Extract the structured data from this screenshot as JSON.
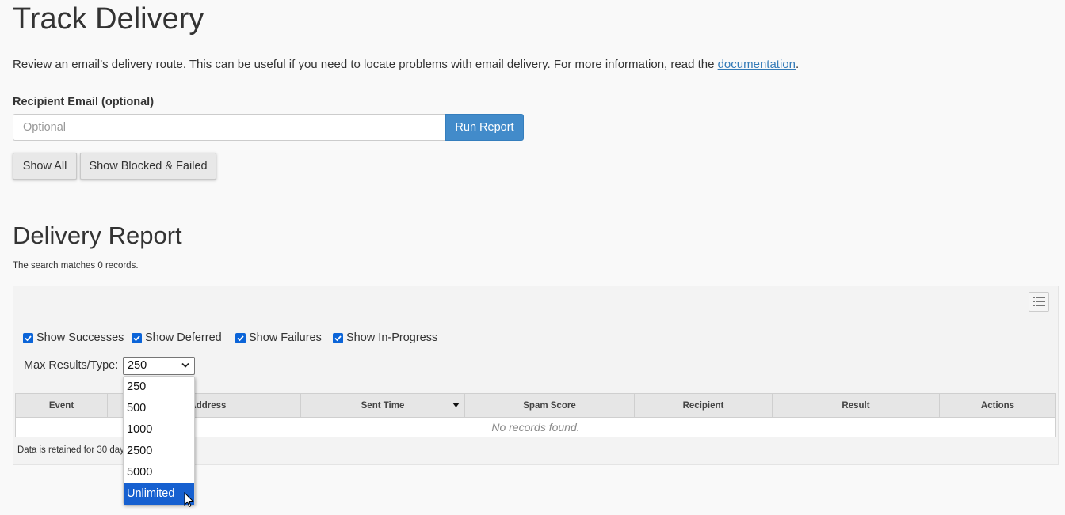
{
  "header": {
    "title": "Track Delivery",
    "description": "Review an email’s delivery route. This can be useful if you need to locate problems with email delivery. For more information, read the ",
    "doc_link": "documentation",
    "desc_end": "."
  },
  "search": {
    "label": "Recipient Email (optional)",
    "placeholder": "Optional",
    "value": "",
    "run_label": "Run Report"
  },
  "filters": {
    "show_all": "Show All",
    "show_blocked": "Show Blocked & Failed"
  },
  "report": {
    "title": "Delivery Report",
    "matches": "The search matches 0 records.",
    "checkboxes": [
      {
        "label": "Show Successes",
        "checked": true
      },
      {
        "label": "Show Deferred",
        "checked": true
      },
      {
        "label": "Show Failures",
        "checked": true
      },
      {
        "label": "Show In-Progress",
        "checked": true
      }
    ],
    "max_label": "Max Results/Type:",
    "max_value": "250",
    "max_options": [
      "250",
      "500",
      "1000",
      "2500",
      "5000",
      "Unlimited"
    ],
    "highlighted_option": "Unlimited",
    "columns": [
      "Event",
      "n Address",
      "Sent Time",
      "Spam Score",
      "Recipient",
      "Result",
      "Actions"
    ],
    "empty_text": "No records found.",
    "retention_note": "Data is retained for 30 day"
  },
  "colors": {
    "primary": "#428bca",
    "link": "#337ab7",
    "checkbox": "#0b64d8",
    "option_highlight": "#1660d0"
  },
  "icons": [
    "list-view-icon",
    "checkbox-checked-icon",
    "chevron-down-icon",
    "sort-desc-icon",
    "mouse-cursor-icon"
  ]
}
